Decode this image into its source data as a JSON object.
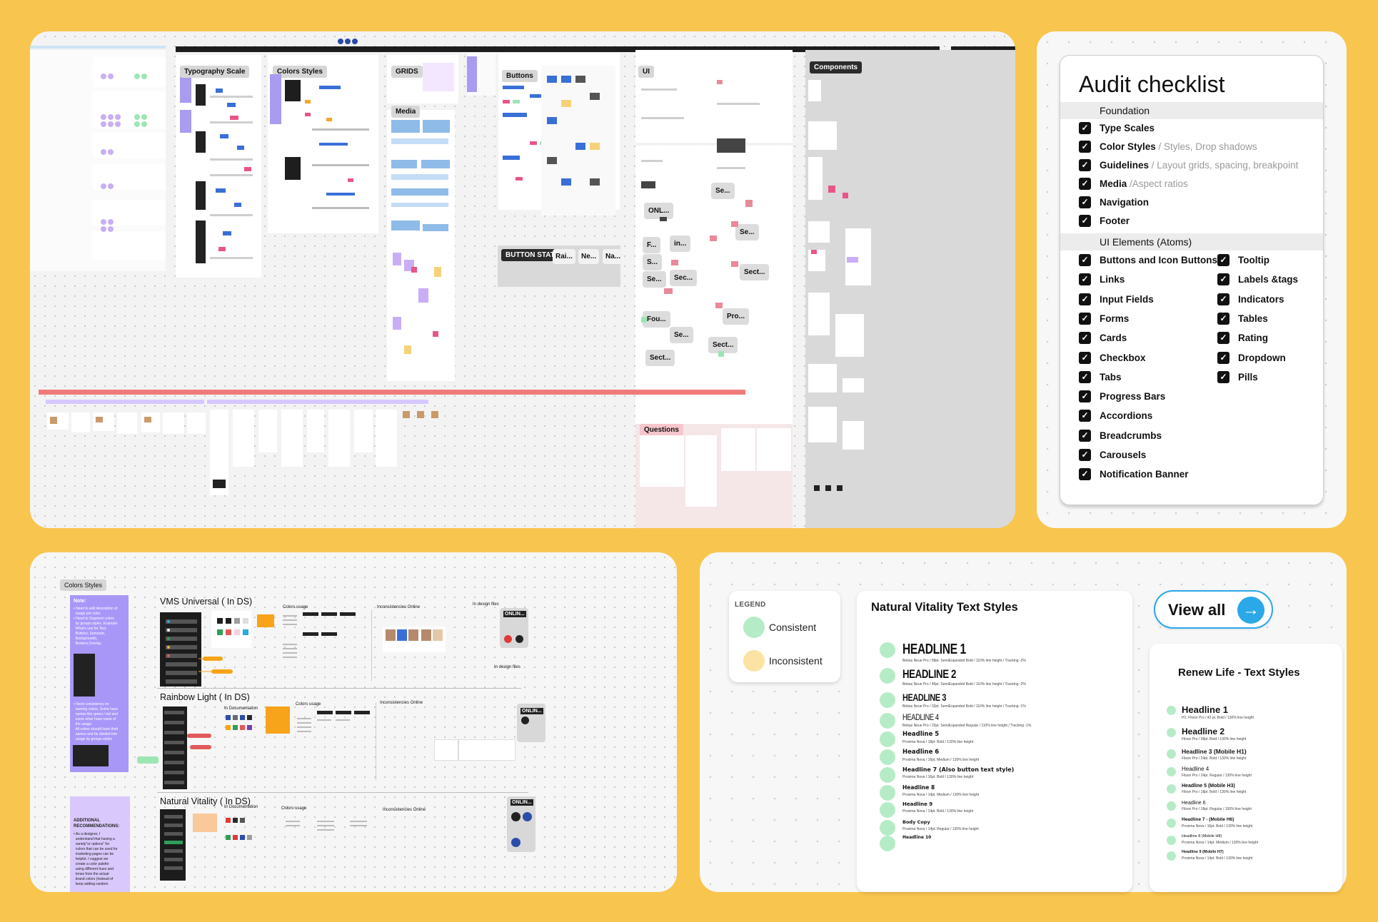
{
  "overview": {
    "typography_tag": "Typography Scale",
    "colors_tag": "Colors Styles",
    "grids_tag": "GRIDS",
    "media_tag": "Media",
    "buttons_tag": "Buttons",
    "button_states_tag": "BUTTON STATES",
    "ui_tag": "UI",
    "components_tag": "Components",
    "questions_tag": "Questions",
    "chips": [
      "Rai...",
      "Ne...",
      "Na...",
      "Se...",
      "ONL...",
      "Se...",
      "F...",
      "in...",
      "S...",
      "Se...",
      "Sec...",
      "Sect...",
      "Fou...",
      "Pro...",
      "Se...",
      "Sect...",
      "Sect..."
    ]
  },
  "checklist": {
    "title": "Audit checklist",
    "sections": [
      {
        "label": "Foundation"
      },
      {
        "label": "UI Elements (Atoms)"
      }
    ],
    "foundation": [
      {
        "label": "Type Scales",
        "sub": ""
      },
      {
        "label": "Color Styles",
        "sub": " / Styles, Drop shadows"
      },
      {
        "label": "Guidelines",
        "sub": " / Layout grids, spacing, breakpoint"
      },
      {
        "label": "Media",
        "sub": " /Aspect ratios"
      },
      {
        "label": "Navigation",
        "sub": ""
      },
      {
        "label": "Footer",
        "sub": ""
      }
    ],
    "atoms_left": [
      "Buttons and Icon  Buttons",
      "Links",
      "Input Fields",
      "Forms",
      "Cards",
      "Checkbox",
      "Tabs",
      "Progress Bars",
      "Accordions",
      "Breadcrumbs",
      "Carousels",
      "Notification Banner"
    ],
    "atoms_right": [
      "Tooltip",
      "Labels &tags",
      "Indicators",
      "Tables",
      "Rating",
      "Dropdown",
      "Pills"
    ],
    "check_glyph": "✓"
  },
  "colors_board": {
    "tag": "Colors Styles",
    "note_title": "Note:",
    "note_lines": [
      "• Need to add description of",
      "  usage per color.",
      "• Need to Segment colors",
      "  by groups styles. Example:",
      "  What's use for Text,",
      "  Buttons, Semantic,",
      "  Backgrounds,",
      "  Borders,Overlay"
    ],
    "note_lines2": [
      "• Need consistency on",
      "  naming colors. Some have",
      "  names like green / red and",
      "  some other have name of",
      "  the usage.",
      "  All colors should have their",
      "  names and be divided into",
      "  usage by groups styles"
    ],
    "rec_title": "ADDITIONAL RECOMMENDATIONS:",
    "rec_lines": [
      "• As a designer, I",
      "  understand that having a",
      "  variety\"or options\" for",
      "  colors that can be used for",
      "  marketing pages can be",
      "  helpful. I suggest we",
      "  create a color palette",
      "  using different hues and",
      "  tones from the actual",
      "  brand colors (Instead of",
      "  keep adding random"
    ],
    "sections": [
      {
        "title": "VMS Universal ( In DS)"
      },
      {
        "title": "Rainbow Light  ( In DS)"
      },
      {
        "title": "Natural Vitality ( In DS)"
      }
    ],
    "colors_usage": "Colors usage",
    "in_documentation": "In Documentation",
    "inconsistencies": "Inconsistencies Online",
    "in_design_files": "In design files",
    "online": "ONLIN..."
  },
  "legend": {
    "title": "LEGEND",
    "consistent": "Consistent",
    "inconsistent": "Inconsistent",
    "consistent_color": "#b5ecc7",
    "inconsistent_color": "#fbe3a3"
  },
  "natural_vitality": {
    "title": "Natural Vitality Text Styles",
    "styles": [
      {
        "name": "HEADLINE 1",
        "spec": "Bebas Neue Pro / 58pt. SemiExpanded Bold / 110% line height / Tracking -2%"
      },
      {
        "name": "HEADLINE 2",
        "spec": "Bebas Neue Pro / 46pt. SemiExpanded Bold / 110% line height / Tracking -2%"
      },
      {
        "name": "HEADLINE 3",
        "spec": "Bebas Neue Pro / 32pt. SemiExpanded Bold / 110% line height / Tracking -1%"
      },
      {
        "name": "HEADLINE 4",
        "spec": "Bebas Neue Pro / 22pt. SemiExpanded Regular / 110% line height / Tracking -1%"
      },
      {
        "name": "Headline 5",
        "spec": "Proxima Nova / 18pt. Bold / 130% line height"
      },
      {
        "name": "Headline 6",
        "spec": "Proxima Nova / 16pt. Medium / 130% line height"
      },
      {
        "name": "Headline 7 (Also button text style)",
        "spec": "Proxima Nova / 16pt. Bold / 130% line height"
      },
      {
        "name": "Headline 8",
        "spec": "Proxima Nova / 14pt. Medium / 130% line height"
      },
      {
        "name": "Headline 9",
        "spec": "Proxima Nova / 14pt. Bold / 130% line height"
      },
      {
        "name": "Body Copy",
        "spec": "Proxima Nova / 14pt. Regular / 130% line height"
      },
      {
        "name": "Headline 10",
        "spec": ""
      }
    ]
  },
  "view_all": {
    "label": "View all",
    "arrow": "→"
  },
  "renew_life": {
    "title": "Renew Life - Text Styles",
    "styles": [
      {
        "name": "Headline 1",
        "spec": "H1: Filson Pro / 42 pt. Bold / 130% line height"
      },
      {
        "name": "Headline 2",
        "spec": "Filson Pro / 38pt. Bold / 130% line height"
      },
      {
        "name": "Headline 3 (Mobile H1)",
        "spec": "Filson Pro / 24pt. Bold / 130% line height"
      },
      {
        "name": "Headline 4",
        "spec": "Filson Pro / 24pt. Regular / 130% line height"
      },
      {
        "name": "Headline 5 (Mobile H3)",
        "spec": "Filson Pro / 18pt. Bold / 130% line height"
      },
      {
        "name": "Headline 6",
        "spec": "Filson Pro / 18pt. Regular / 150% line height"
      },
      {
        "name": "Headline 7 - (Mobile H6)",
        "spec": "Proxima Nova / 16pt. Bold / 130% line height"
      },
      {
        "name": "Headline 8 (Mobile H8)",
        "spec": "Proxima Nova / 14pt. Medium / 130% line height"
      },
      {
        "name": "Headline 9 (Mobile H7)",
        "spec": "Proxima Nova / 14pt. Bold / 130% line height"
      }
    ]
  }
}
